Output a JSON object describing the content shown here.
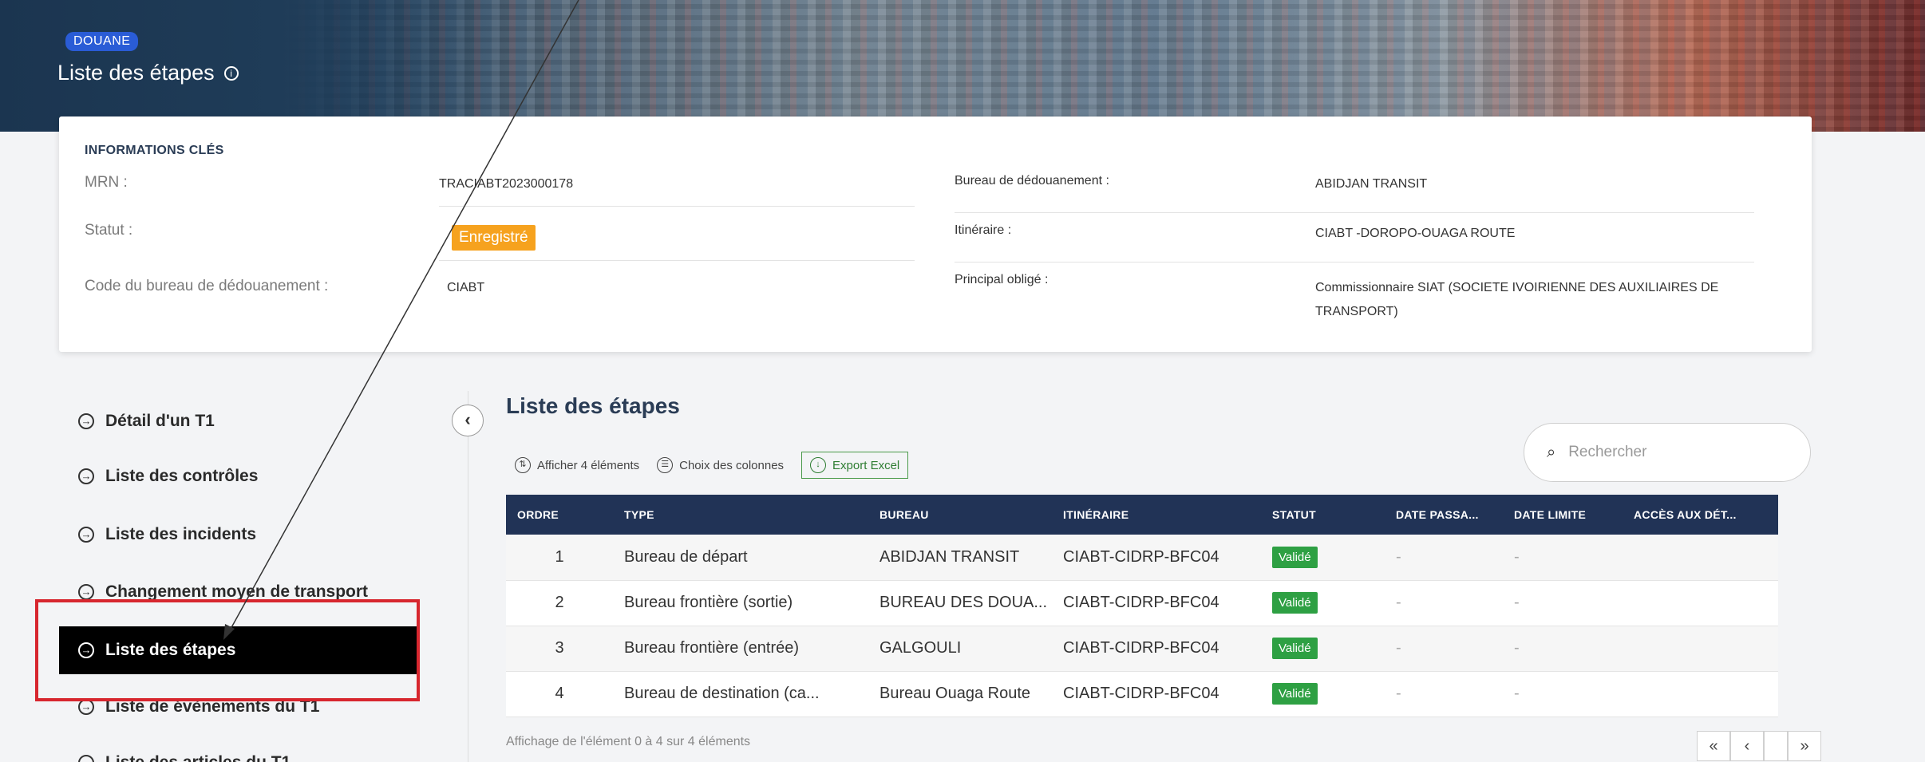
{
  "header": {
    "badge": "DOUANE",
    "title": "Liste des étapes",
    "info_icon": "info-circle-icon"
  },
  "key_info": {
    "heading": "INFORMATIONS CLÉS",
    "left": [
      {
        "label": "MRN :",
        "value": "TRACIABT2023000178"
      },
      {
        "label": "Statut :",
        "value": "Enregistré",
        "status_color": "#f6a21e"
      },
      {
        "label": "Code du bureau de dédouanement :",
        "value": "CIABT"
      }
    ],
    "right": [
      {
        "label": "Bureau de dédouanement :",
        "value": "ABIDJAN TRANSIT"
      },
      {
        "label": "Itinéraire :",
        "value": "CIABT -DOROPO-OUAGA ROUTE"
      },
      {
        "label": "Principal obligé :",
        "value": "Commissionnaire SIAT (SOCIETE IVOIRIENNE DES AUXILIAIRES DE TRANSPORT)"
      }
    ]
  },
  "sidebar": {
    "items": [
      {
        "label": "Détail d'un T1",
        "active": false
      },
      {
        "label": "Liste des contrôles",
        "active": false
      },
      {
        "label": "Liste des incidents",
        "active": false
      },
      {
        "label": "Changement moyen de transport",
        "active": false
      },
      {
        "label": "Liste des étapes",
        "active": true
      },
      {
        "label": "Liste de évènements du T1",
        "active": false
      },
      {
        "label": "Liste des articles du T1",
        "active": false
      }
    ],
    "item_icon": "arrow-right-circle-icon",
    "collapse_icon": "chevron-left-icon"
  },
  "main": {
    "title": "Liste des étapes",
    "toolbar": {
      "show_items": "Afficher 4 éléments",
      "columns": "Choix des colonnes",
      "export": "Export Excel"
    },
    "search": {
      "placeholder": "Rechercher",
      "value": ""
    },
    "table": {
      "columns": [
        "ORDRE",
        "TYPE",
        "BUREAU",
        "ITINÉRAIRE",
        "STATUT",
        "DATE PASSA...",
        "DATE LIMITE",
        "ACCÈS AUX DÉT..."
      ],
      "rows": [
        {
          "ordre": "1",
          "type": "Bureau de départ",
          "bureau": "ABIDJAN TRANSIT",
          "itineraire": "CIABT-CIDRP-BFC04",
          "statut": "Validé",
          "date_passage": "-",
          "date_limite": "-"
        },
        {
          "ordre": "2",
          "type": "Bureau frontière (sortie)",
          "bureau": "BUREAU DES DOUA...",
          "itineraire": "CIABT-CIDRP-BFC04",
          "statut": "Validé",
          "date_passage": "-",
          "date_limite": "-"
        },
        {
          "ordre": "3",
          "type": "Bureau frontière (entrée)",
          "bureau": "GALGOULI",
          "itineraire": "CIABT-CIDRP-BFC04",
          "statut": "Validé",
          "date_passage": "-",
          "date_limite": "-"
        },
        {
          "ordre": "4",
          "type": "Bureau de destination (ca...",
          "bureau": "Bureau Ouaga Route",
          "itineraire": "CIABT-CIDRP-BFC04",
          "statut": "Validé",
          "date_passage": "-",
          "date_limite": "-"
        }
      ],
      "status_color": "#2ea043",
      "header_color": "#213356"
    },
    "footer": "Affichage de l'élément 0 à 4 sur 4 éléments",
    "pager": {
      "first": "«",
      "prev": "‹",
      "next": "»"
    }
  }
}
